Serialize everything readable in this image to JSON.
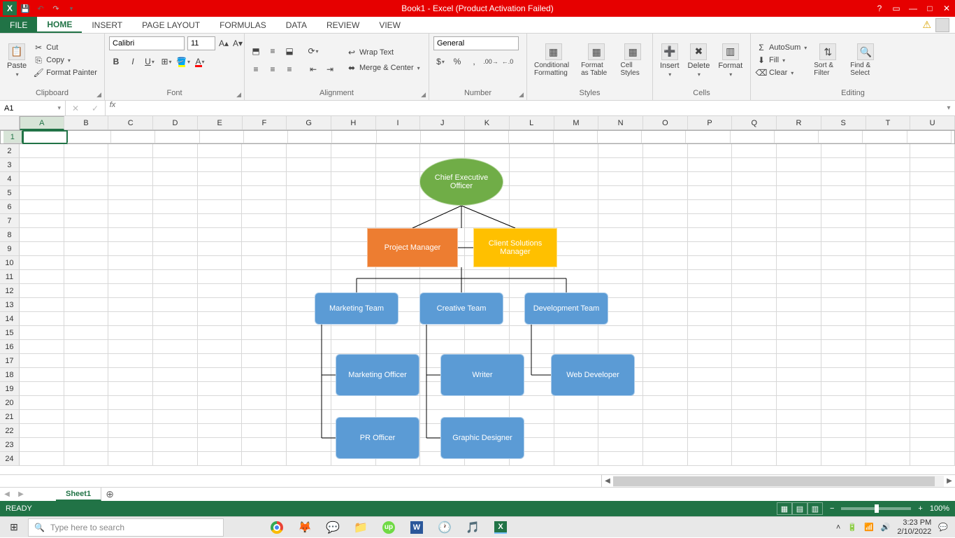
{
  "titlebar": {
    "title": "Book1 -  Excel (Product Activation Failed)"
  },
  "tabs": {
    "file": "FILE",
    "items": [
      "HOME",
      "INSERT",
      "PAGE LAYOUT",
      "FORMULAS",
      "DATA",
      "REVIEW",
      "VIEW"
    ],
    "active": "HOME"
  },
  "ribbon": {
    "clipboard": {
      "paste": "Paste",
      "cut": "Cut",
      "copy": "Copy",
      "painter": "Format Painter",
      "label": "Clipboard"
    },
    "font": {
      "name": "Calibri",
      "size": "11",
      "label": "Font"
    },
    "alignment": {
      "wrap": "Wrap Text",
      "merge": "Merge & Center",
      "label": "Alignment"
    },
    "number": {
      "format": "General",
      "label": "Number"
    },
    "styles": {
      "cond": "Conditional Formatting",
      "table": "Format as Table",
      "cell": "Cell Styles",
      "label": "Styles"
    },
    "cells": {
      "insert": "Insert",
      "delete": "Delete",
      "format": "Format",
      "label": "Cells"
    },
    "editing": {
      "autosum": "AutoSum",
      "fill": "Fill",
      "clear": "Clear",
      "sort": "Sort & Filter",
      "find": "Find & Select",
      "label": "Editing"
    }
  },
  "namebox": "A1",
  "columns": [
    "A",
    "B",
    "C",
    "D",
    "E",
    "F",
    "G",
    "H",
    "I",
    "J",
    "K",
    "L",
    "M",
    "N",
    "O",
    "P",
    "Q",
    "R",
    "S",
    "T",
    "U"
  ],
  "org": {
    "ceo": "Chief Executive Officer",
    "pm": "Project Manager",
    "csm": "Client Solutions Manager",
    "mt": "Marketing Team",
    "ct": "Creative Team",
    "dt": "Development Team",
    "mo": "Marketing Officer",
    "wr": "Writer",
    "wd": "Web Developer",
    "pr": "PR Officer",
    "gd": "Graphic Designer"
  },
  "sheet": {
    "name": "Sheet1"
  },
  "status": {
    "ready": "READY",
    "zoom": "100%"
  },
  "taskbar": {
    "search_placeholder": "Type here to search",
    "time": "3:23 PM",
    "date": "2/10/2022"
  }
}
